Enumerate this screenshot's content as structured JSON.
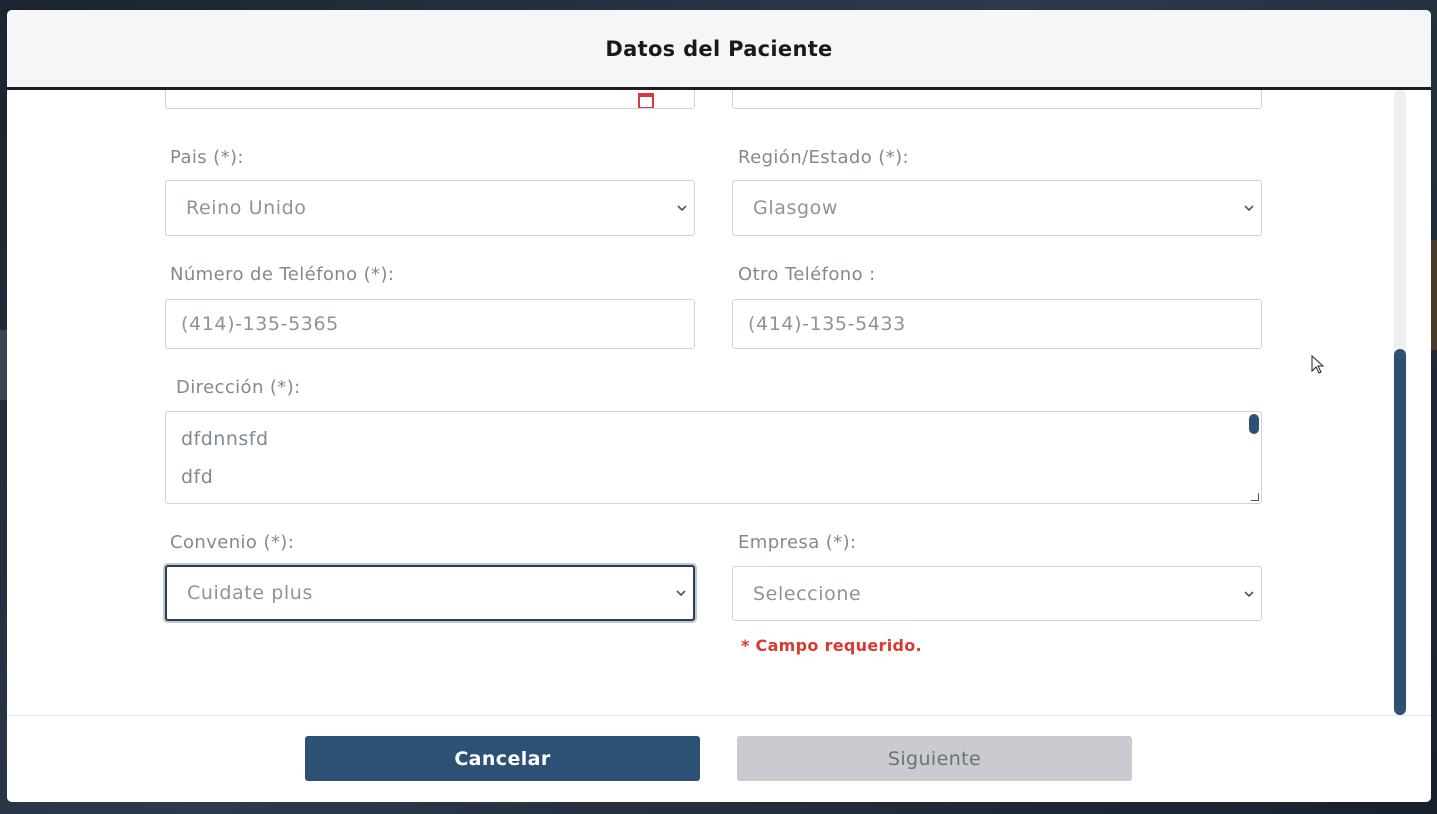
{
  "modal": {
    "title": "Datos del Paciente"
  },
  "fields": {
    "pais": {
      "label": "Pais (*):",
      "value": "Reino Unido"
    },
    "region": {
      "label": "Región/Estado (*):",
      "value": "Glasgow"
    },
    "telefono": {
      "label": "Número de Teléfono (*):",
      "value": "(414)-135-5365"
    },
    "otro_telefono": {
      "label": "Otro Teléfono :",
      "value": "(414)-135-5433"
    },
    "direccion": {
      "label": "Dirección (*):",
      "lines": [
        "dfdnnsfd",
        "dfd"
      ]
    },
    "convenio": {
      "label": "Convenio (*):",
      "value": "Cuidate plus"
    },
    "empresa": {
      "label": "Empresa (*):",
      "value": "Seleccione",
      "error": "* Campo requerido."
    }
  },
  "footer": {
    "cancel_label": "Cancelar",
    "next_label": "Siguiente"
  },
  "colors": {
    "primary": "#2c5175",
    "error": "#d83a2e",
    "disabled": "#c9cbd0"
  },
  "icons": {
    "select_arrow": "chevron-down-icon",
    "calendar": "calendar-icon",
    "cursor": "mouse-pointer-icon"
  }
}
